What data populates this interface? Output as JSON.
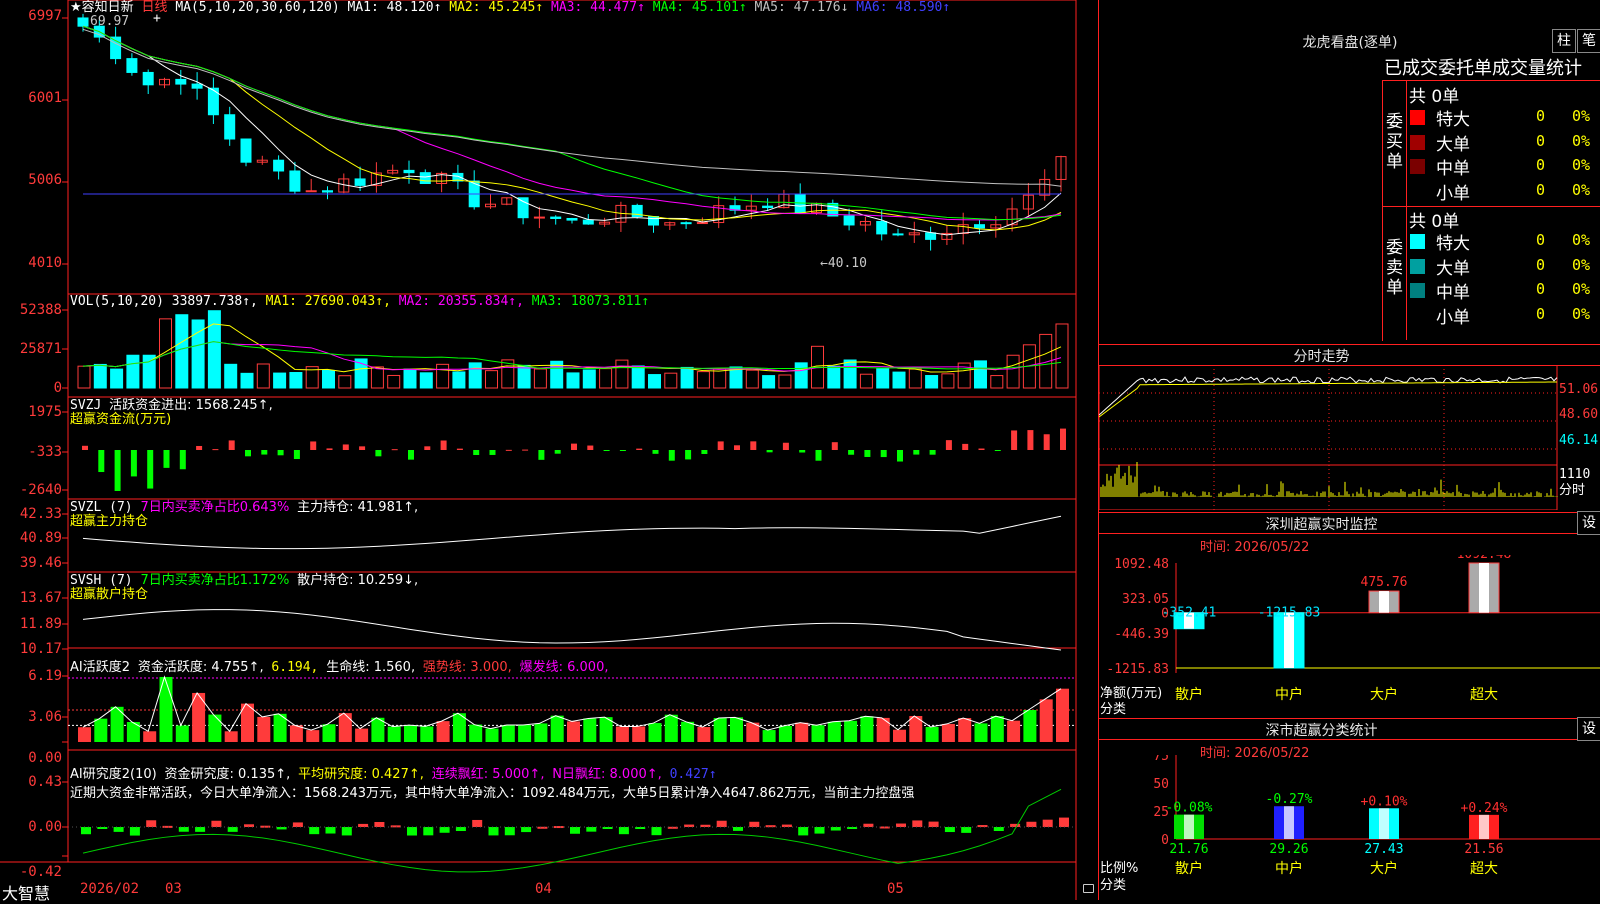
{
  "app": {
    "brand": "大智慧"
  },
  "main_chart": {
    "header": {
      "star_title": "★容知日新",
      "period": "日线",
      "ma_params": "MA(5,10,20,30,60,120)",
      "ma1": "MA1: 48.120↑",
      "ma2": "MA2: 45.245↑",
      "ma3": "MA3: 44.477↑",
      "ma4": "MA4: 45.101↑",
      "ma5": "MA5: 47.176↓",
      "ma6": "MA6: 48.590↑"
    },
    "y_ticks": [
      "6997",
      "6001",
      "5006",
      "4010"
    ],
    "annotations": {
      "high_label": "69.97",
      "low_label": "←40.10"
    }
  },
  "vol_panel": {
    "header": {
      "name": "VOL(5,10,20)",
      "value": "33897.738↑,",
      "ma1": "MA1: 27690.043↑,",
      "ma2": "MA2: 20355.834↑,",
      "ma3": "MA3: 18073.811↑"
    },
    "y_ticks": [
      "52388",
      "25871",
      "0"
    ]
  },
  "svzj_panel": {
    "header": {
      "name": "SVZJ",
      "text": "活跃资金进出: 1568.245↑,",
      "subtitle": "超赢资金流(万元)"
    },
    "y_ticks": [
      "1975",
      "-333",
      "-2640"
    ]
  },
  "svzl_panel": {
    "header": {
      "name": "SVZL (7)",
      "ratio": "7日内买卖净占比0.643%",
      "hold": "主力持仓: 41.981↑,",
      "subtitle": "超赢主力持仓"
    },
    "y_ticks": [
      "42.33",
      "40.89",
      "39.46"
    ]
  },
  "svsh_panel": {
    "header": {
      "name": "SVSH (7)",
      "ratio": "7日内买卖净占比1.172%",
      "hold": "散户持仓: 10.259↓,",
      "subtitle": "超赢散户持仓"
    },
    "y_ticks": [
      "13.67",
      "11.89",
      "10.17"
    ]
  },
  "ai_active_panel": {
    "header": {
      "name": "AI活跃度2",
      "a": "资金活跃度: 4.755↑,",
      "b": "6.194,",
      "c": "生命线: 1.560,",
      "d": "强势线: 3.000,",
      "e": "爆发线: 6.000,"
    },
    "y_ticks": [
      "6.19",
      "3.06",
      "0.00"
    ]
  },
  "ai_research_panel": {
    "header": {
      "name": "AI研究度2(10)",
      "a": "资金研究度: 0.135↑,",
      "b": "平均研究度: 0.427↑,",
      "c": "连续飘红: 5.000↑,",
      "d": "N日飘红: 8.000↑,",
      "e": "0.427↑"
    },
    "comment": "近期大资金非常活跃，今日大单净流入：1568.243万元，其中特大单净流入：1092.484万元，大单5日累计净入4647.862万元，当前主力控盘强",
    "y_ticks": [
      "0.43",
      "0.00",
      "-0.42"
    ]
  },
  "date_axis": {
    "labels": [
      "2026/02",
      "03",
      "04",
      "05"
    ]
  },
  "right_panel": {
    "dragon": {
      "title": "龙虎看盘(逐单)",
      "btn_a": "柱",
      "btn_b": "笔",
      "table_title": "已成交委托单成交量统计",
      "buy": {
        "label": "委买单",
        "total": "共 0单",
        "rows": [
          {
            "name": "特大",
            "count": "0",
            "pct": "0%",
            "color": "#ff0000"
          },
          {
            "name": "大单",
            "count": "0",
            "pct": "0%",
            "color": "#a00000"
          },
          {
            "name": "中单",
            "count": "0",
            "pct": "0%",
            "color": "#7a0000"
          },
          {
            "name": "小单",
            "count": "0",
            "pct": "0%",
            "color": ""
          }
        ]
      },
      "sell": {
        "label": "委卖单",
        "total": "共 0单",
        "rows": [
          {
            "name": "特大",
            "count": "0",
            "pct": "0%",
            "color": "#00ffff"
          },
          {
            "name": "大单",
            "count": "0",
            "pct": "0%",
            "color": "#00a0a0"
          },
          {
            "name": "中单",
            "count": "0",
            "pct": "0%",
            "color": "#008080"
          },
          {
            "name": "小单",
            "count": "0",
            "pct": "0%",
            "color": ""
          }
        ]
      }
    },
    "intraday": {
      "title": "分时走势",
      "y_ticks": [
        "51.06",
        "48.60",
        "46.14",
        "1110",
        "分时"
      ]
    },
    "sz_monitor": {
      "title": "深圳超赢实时监控",
      "btn": "设",
      "time": "时间: 2026/05/22",
      "y_ticks": [
        "1092.48",
        "323.05",
        "0",
        "-446.39",
        "-1215.83"
      ],
      "axis_unit": "净额(万元)",
      "axis_cat": "分类",
      "bars": [
        {
          "category": "散户",
          "value": -352.41,
          "label": "-352.41",
          "label_color": "#00e5ff"
        },
        {
          "category": "中户",
          "value": -1215.83,
          "label": "-1215.83",
          "label_color": "#00e5ff"
        },
        {
          "category": "大户",
          "value": 475.76,
          "label": "475.76",
          "label_color": "#ff3030"
        },
        {
          "category": "超大",
          "value": 1092.48,
          "label": "1092.48",
          "label_color": "#ff3030"
        }
      ]
    },
    "sz_class": {
      "title": "深市超赢分类统计",
      "btn": "设",
      "time": "时间: 2026/05/22",
      "y_ticks": [
        "75",
        "50",
        "25",
        "0"
      ],
      "axis_unit": "比例%",
      "axis_cat": "分类",
      "bars": [
        {
          "category": "散户",
          "value": 21.76,
          "label": "21.76",
          "change": "-0.08%",
          "change_color": "#00ff00",
          "color": "#00dd00"
        },
        {
          "category": "中户",
          "value": 29.26,
          "label": "29.26",
          "change": "-0.27%",
          "change_color": "#00ff00",
          "color": "#2020ff"
        },
        {
          "category": "大户",
          "value": 27.43,
          "label": "27.43",
          "change": "+0.10%",
          "change_color": "#ff3030",
          "color": "#00ffff"
        },
        {
          "category": "超大",
          "value": 21.56,
          "label": "21.56",
          "change": "+0.24%",
          "change_color": "#ff3030",
          "color": "#ff2020"
        }
      ]
    }
  },
  "colors": {
    "up": "#ff3b3b",
    "down": "#00ffff",
    "panel_border": "#ff2020",
    "ma1": "#ffffff",
    "ma2": "#ffff00",
    "ma3": "#ff00ff",
    "ma4": "#00ff00",
    "ma5": "#c0c0c0",
    "ma6": "#4040ff"
  }
}
